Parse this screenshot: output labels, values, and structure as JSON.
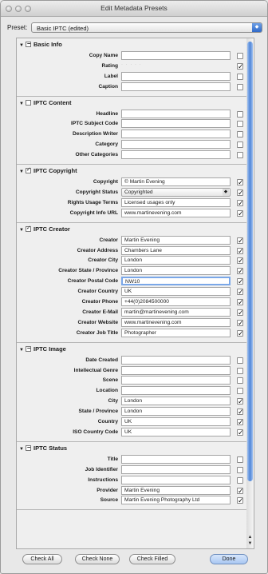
{
  "window": {
    "title": "Edit Metadata Presets"
  },
  "preset": {
    "label": "Preset:",
    "value": "Basic IPTC (edited)"
  },
  "sections": [
    {
      "title": "Basic Info",
      "header_check": "dash",
      "fields": [
        {
          "label": "Copy Name",
          "value": "",
          "checked": false
        },
        {
          "label": "Rating",
          "value": "",
          "checked": true,
          "kind": "rating"
        },
        {
          "label": "Label",
          "value": "",
          "checked": false
        },
        {
          "label": "Caption",
          "value": "",
          "checked": false
        }
      ]
    },
    {
      "title": "IPTC Content",
      "header_check": "empty",
      "fields": [
        {
          "label": "Headline",
          "value": "",
          "checked": false
        },
        {
          "label": "IPTC Subject Code",
          "value": "",
          "checked": false
        },
        {
          "label": "Description Writer",
          "value": "",
          "checked": false
        },
        {
          "label": "Category",
          "value": "",
          "checked": false
        },
        {
          "label": "Other Categories",
          "value": "",
          "checked": false
        }
      ]
    },
    {
      "title": "IPTC Copyright",
      "header_check": "check",
      "fields": [
        {
          "label": "Copyright",
          "value": "© Martin Evening",
          "checked": true
        },
        {
          "label": "Copyright Status",
          "value": "Copyrighted",
          "checked": true,
          "kind": "select"
        },
        {
          "label": "Rights Usage Terms",
          "value": "Licensed usages only",
          "checked": true
        },
        {
          "label": "Copyright Info URL",
          "value": "www.martinevening.com",
          "checked": true
        }
      ]
    },
    {
      "title": "IPTC Creator",
      "header_check": "check",
      "fields": [
        {
          "label": "Creator",
          "value": "Martin Evening",
          "checked": true
        },
        {
          "label": "Creator Address",
          "value": "Chambers Lane",
          "checked": true
        },
        {
          "label": "Creator City",
          "value": "London",
          "checked": true
        },
        {
          "label": "Creator State / Province",
          "value": "London",
          "checked": true
        },
        {
          "label": "Creator Postal Code",
          "value": "NW10",
          "checked": true,
          "kind": "focus"
        },
        {
          "label": "Creator Country",
          "value": "UK",
          "checked": true
        },
        {
          "label": "Creator Phone",
          "value": "+44(0)2084500000",
          "checked": true
        },
        {
          "label": "Creator E-Mail",
          "value": "martin@martinevening.com",
          "checked": true
        },
        {
          "label": "Creator Website",
          "value": "www.martinevening.com",
          "checked": true
        },
        {
          "label": "Creator Job Title",
          "value": "Photographer",
          "checked": true
        }
      ]
    },
    {
      "title": "IPTC Image",
      "header_check": "dash",
      "fields": [
        {
          "label": "Date Created",
          "value": "",
          "checked": false
        },
        {
          "label": "Intellectual Genre",
          "value": "",
          "checked": false
        },
        {
          "label": "Scene",
          "value": "",
          "checked": false
        },
        {
          "label": "Location",
          "value": "",
          "checked": false
        },
        {
          "label": "City",
          "value": "London",
          "checked": true
        },
        {
          "label": "State / Province",
          "value": "London",
          "checked": true
        },
        {
          "label": "Country",
          "value": "UK",
          "checked": true
        },
        {
          "label": "ISO Country Code",
          "value": "UK",
          "checked": true
        }
      ]
    },
    {
      "title": "IPTC Status",
      "header_check": "dash",
      "fields": [
        {
          "label": "Title",
          "value": "",
          "checked": false
        },
        {
          "label": "Job Identifier",
          "value": "",
          "checked": false
        },
        {
          "label": "Instructions",
          "value": "",
          "checked": false
        },
        {
          "label": "Provider",
          "value": "Martin Evening",
          "checked": true
        },
        {
          "label": "Source",
          "value": "Martin Evening Photography Ltd",
          "checked": true
        }
      ]
    }
  ],
  "buttons": {
    "check_all": "Check All",
    "check_none": "Check None",
    "check_filled": "Check Filled",
    "done": "Done"
  }
}
